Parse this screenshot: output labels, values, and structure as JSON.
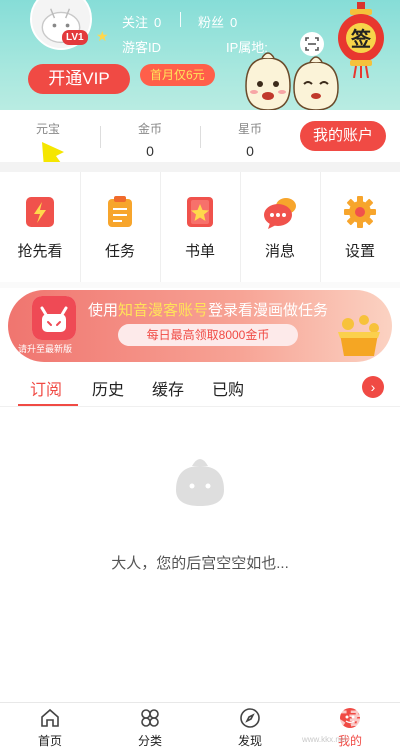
{
  "profile": {
    "level_badge": "LV1",
    "follow_label": "关注",
    "follow_count": "0",
    "fans_label": "粉丝",
    "fans_count": "0",
    "guest_id": "游客ID",
    "ip_location": "IP属地:",
    "sign_in_label": "签",
    "vip_button": "开通VIP",
    "vip_promo": "首月仅6元"
  },
  "wallet": {
    "yuanbao_label": "元宝",
    "yuanbao_value": "0",
    "coin_label": "金币",
    "coin_value": "0",
    "star_label": "星币",
    "star_value": "0",
    "account_button": "我的账户"
  },
  "menu": [
    {
      "label": "抢先看",
      "icon": "lightning-book-icon"
    },
    {
      "label": "任务",
      "icon": "clipboard-icon"
    },
    {
      "label": "书单",
      "icon": "star-book-icon"
    },
    {
      "label": "消息",
      "icon": "chat-bubble-icon"
    },
    {
      "label": "设置",
      "icon": "gear-icon"
    }
  ],
  "banner": {
    "update_text": "请升至最新版",
    "title_prefix": "使用",
    "title_highlight": "知音漫客账号",
    "title_suffix": "登录看漫画做任务",
    "reward": "每日最高领取8000金币"
  },
  "tabs": [
    "订阅",
    "历史",
    "缓存",
    "已购"
  ],
  "empty_message": "大人，您的后宫空空如也...",
  "bottom_nav": [
    {
      "label": "首页",
      "icon": "home-icon"
    },
    {
      "label": "分类",
      "icon": "grid-icon"
    },
    {
      "label": "发现",
      "icon": "compass-icon"
    },
    {
      "label": "我的",
      "icon": "profile-icon"
    }
  ],
  "watermark": "KK下载",
  "watermark_url": "www.kkx.net",
  "colors": {
    "accent": "#f04a44",
    "header": "#86ddd7",
    "highlight": "#ffe35a"
  }
}
